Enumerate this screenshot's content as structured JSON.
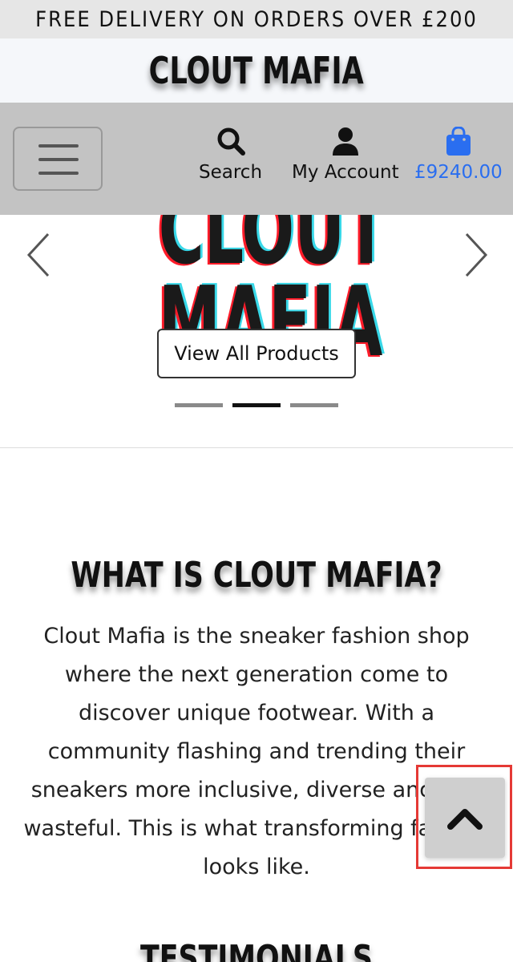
{
  "banner": {
    "text": "FREE DELIVERY ON ORDERS OVER £200"
  },
  "brand": {
    "name": "CLOUT MAFIA"
  },
  "nav": {
    "search_label": "Search",
    "account_label": "My Account",
    "cart_total": "£9240.00",
    "cart_color": "#2a6ef0"
  },
  "hero": {
    "art_top": "CLOUT",
    "art_bottom": "MAFIA",
    "cta_label": "View All Products",
    "slides": 3,
    "active_slide": 2
  },
  "about": {
    "title": "WHAT IS CLOUT MAFIA?",
    "text": "Clout Mafia is the sneaker fashion shop where the next generation come to discover unique footwear. With a community flashing and trending their sneakers more inclusive, diverse and less wasteful. This is what transforming fashion looks like."
  },
  "testimonials": {
    "title": "TESTIMONIALS"
  },
  "icons": {
    "menu": "hamburger-icon",
    "search": "search-icon",
    "account": "user-icon",
    "cart": "shopping-bag-icon",
    "back_to_top": "chevron-up-icon"
  }
}
